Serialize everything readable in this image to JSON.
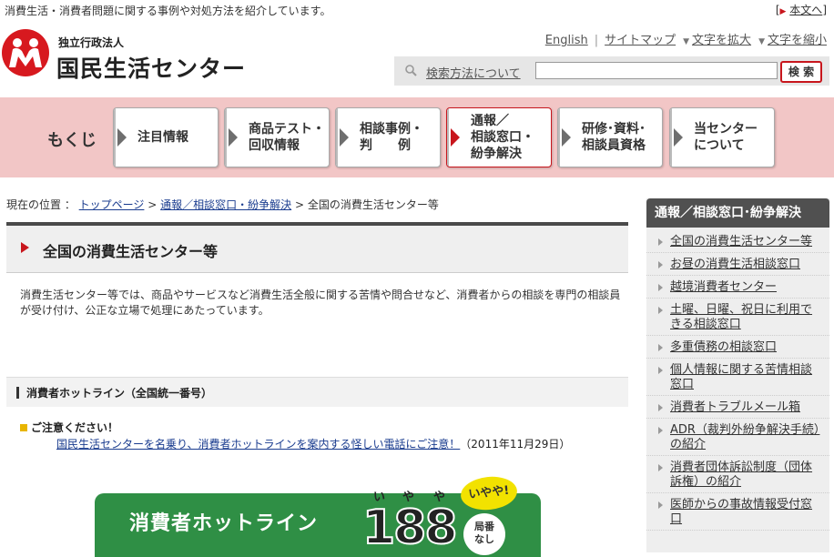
{
  "topbar": {
    "tagline": "消費生活・消費者問題に関する事例や対処方法を紹介しています。",
    "skip_label": "本文へ"
  },
  "header": {
    "org_type": "独立行政法人",
    "org_name": "国民生活センター",
    "links": {
      "english": "English",
      "sitemap": "サイトマップ",
      "enlarge": "文字を拡大",
      "shrink": "文字を縮小"
    },
    "search": {
      "howto": "検索方法について",
      "value": "",
      "button": "検 索"
    }
  },
  "nav": {
    "label": "もくじ",
    "items": [
      {
        "label": "注目情報",
        "active": false
      },
      {
        "label": "商品テスト・\n回収情報",
        "active": false
      },
      {
        "label": "相談事例・\n判　　例",
        "active": false
      },
      {
        "label": "通報／\n相談窓口・\n紛争解決",
        "active": true
      },
      {
        "label": "研修･資料･\n相談員資格",
        "active": false
      },
      {
        "label": "当センター\nについて",
        "active": false
      }
    ]
  },
  "breadcrumb": {
    "prefix": "現在の位置 ：",
    "home": "トップページ",
    "sep": ">",
    "parent": "通報／相談窓口・紛争解決",
    "current": "全国の消費生活センター等"
  },
  "main": {
    "title": "全国の消費生活センター等",
    "intro": "消費生活センター等では、商品やサービスなど消費生活全般に関する苦情や問合せなど、消費者からの相談を専門の相談員が受け付け、公正な立場で処理にあたっています。",
    "section_title": "消費者ホットライン（全国統一番号）",
    "notice_heading": "ご注意ください！",
    "notice_link": "国民生活センターを名乗り、消費者ホットラインを案内する怪しい電話にご注意！",
    "notice_date": "（2011年11月29日）",
    "banner": {
      "text": "消費者ホットライン",
      "number": "188",
      "ruby": [
        "い",
        "や",
        "や"
      ],
      "bubble": "いやや!",
      "badge": "局番\nなし"
    }
  },
  "sidebar": {
    "title": "通報／相談窓口･紛争解決",
    "items": [
      "全国の消費生活センター等",
      "お昼の消費生活相談窓口",
      "越境消費者センター",
      "土曜、日曜、祝日に利用できる相談窓口",
      "多重債務の相談窓口",
      "個人情報に関する苦情相談窓口",
      "消費者トラブルメール箱",
      "ADR（裁判外紛争解決手続）の紹介",
      "消費者団体訴訟制度（団体訴権）の紹介",
      "医師からの事故情報受付窓口"
    ]
  },
  "colors": {
    "accent_red": "#c8161d",
    "nav_bg": "#f2c6c6",
    "banner_green": "#2f8f45",
    "sidebar_header": "#505050"
  }
}
